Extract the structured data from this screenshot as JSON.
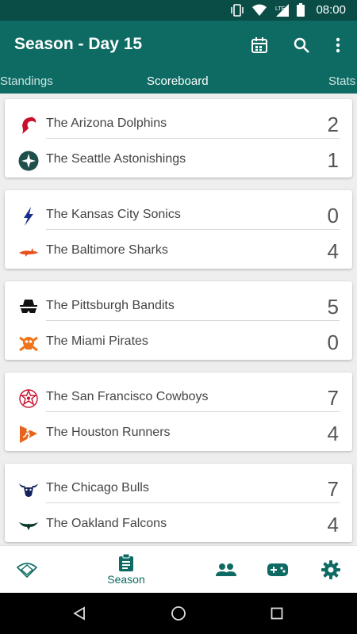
{
  "status_bar": {
    "time": "08:00",
    "network": "LTE"
  },
  "app_bar": {
    "title": "Season - Day 15"
  },
  "tabs": [
    {
      "label": "Standings",
      "active": false
    },
    {
      "label": "Scoreboard",
      "active": true
    },
    {
      "label": "Stats",
      "active": false
    }
  ],
  "games": [
    {
      "home": {
        "name": "The Arizona Dolphins",
        "score": "2",
        "logo": "dolphin-icon",
        "color": "#c8102e"
      },
      "away": {
        "name": "The Seattle Astonishings",
        "score": "1",
        "logo": "compass-star-icon",
        "color": "#1f4f4a"
      }
    },
    {
      "home": {
        "name": "The Kansas City Sonics",
        "score": "0",
        "logo": "lightning-bolt-icon",
        "color": "#1a2d8c"
      },
      "away": {
        "name": "The Baltimore Sharks",
        "score": "4",
        "logo": "shark-icon",
        "color": "#e8501c"
      }
    },
    {
      "home": {
        "name": "The Pittsburgh Bandits",
        "score": "5",
        "logo": "bandit-mask-icon",
        "color": "#111111"
      },
      "away": {
        "name": "The Miami Pirates",
        "score": "0",
        "logo": "skull-crossbones-icon",
        "color": "#f0741a"
      }
    },
    {
      "home": {
        "name": "The San Francisco Cowboys",
        "score": "7",
        "logo": "sheriff-star-icon",
        "color": "#c8102e"
      },
      "away": {
        "name": "The Houston Runners",
        "score": "4",
        "logo": "runner-icon",
        "color": "#e8641c"
      }
    },
    {
      "home": {
        "name": "The Chicago Bulls",
        "score": "7",
        "logo": "bull-icon",
        "color": "#14215c"
      },
      "away": {
        "name": "The Oakland Falcons",
        "score": "4",
        "logo": "falcon-icon",
        "color": "#0b3b2c"
      }
    }
  ],
  "bottom_nav": [
    {
      "label": "",
      "icon": "baseball-field-icon"
    },
    {
      "label": "Season",
      "icon": "clipboard-icon"
    },
    {
      "label": "",
      "icon": "people-icon"
    },
    {
      "label": "",
      "icon": "gamepad-icon"
    },
    {
      "label": "",
      "icon": "gear-icon"
    }
  ],
  "colors": {
    "primary": "#0e6b63",
    "primary_dark": "#0a4d47",
    "background": "#eeeeee"
  }
}
